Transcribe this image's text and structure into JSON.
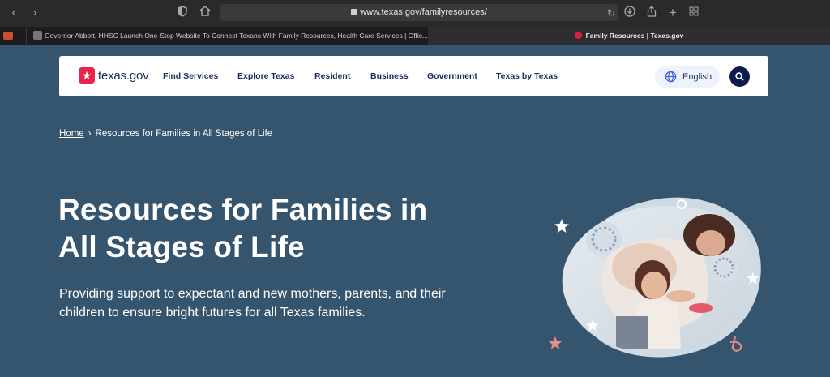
{
  "browser": {
    "url": "www.texas.gov/familyresources/",
    "tabs": [
      {
        "title": "Governor Abbott, HHSC Launch One-Stop Website To Connect Texans With Family Resources, Health Care Services | Offic...",
        "active": false
      },
      {
        "title": "Family Resources | Texas.gov",
        "active": true
      }
    ],
    "icons": [
      "back-icon",
      "forward-icon",
      "shield-icon",
      "home-icon",
      "reload-icon",
      "download-icon",
      "share-icon",
      "new-tab-icon",
      "tab-overview-icon"
    ]
  },
  "header": {
    "logo_text": "texas.gov",
    "nav": [
      {
        "label": "Find Services"
      },
      {
        "label": "Explore Texas"
      },
      {
        "label": "Resident"
      },
      {
        "label": "Business"
      },
      {
        "label": "Government"
      },
      {
        "label": "Texas by Texas"
      }
    ],
    "language_label": "English"
  },
  "breadcrumb": {
    "home": "Home",
    "separator": "›",
    "current": "Resources for Families in All Stages of Life"
  },
  "hero": {
    "title_line1": "Resources for Families in",
    "title_line2": "All Stages of Life",
    "subtitle_line1": "Providing support to expectant and new mothers, parents, and their",
    "subtitle_line2": "children to ensure bright futures for all Texas families."
  },
  "colors": {
    "page_bg": "#35556f",
    "brand_red": "#e8254d",
    "navy": "#1b2d5c",
    "accent_star": "#e88b8b"
  }
}
